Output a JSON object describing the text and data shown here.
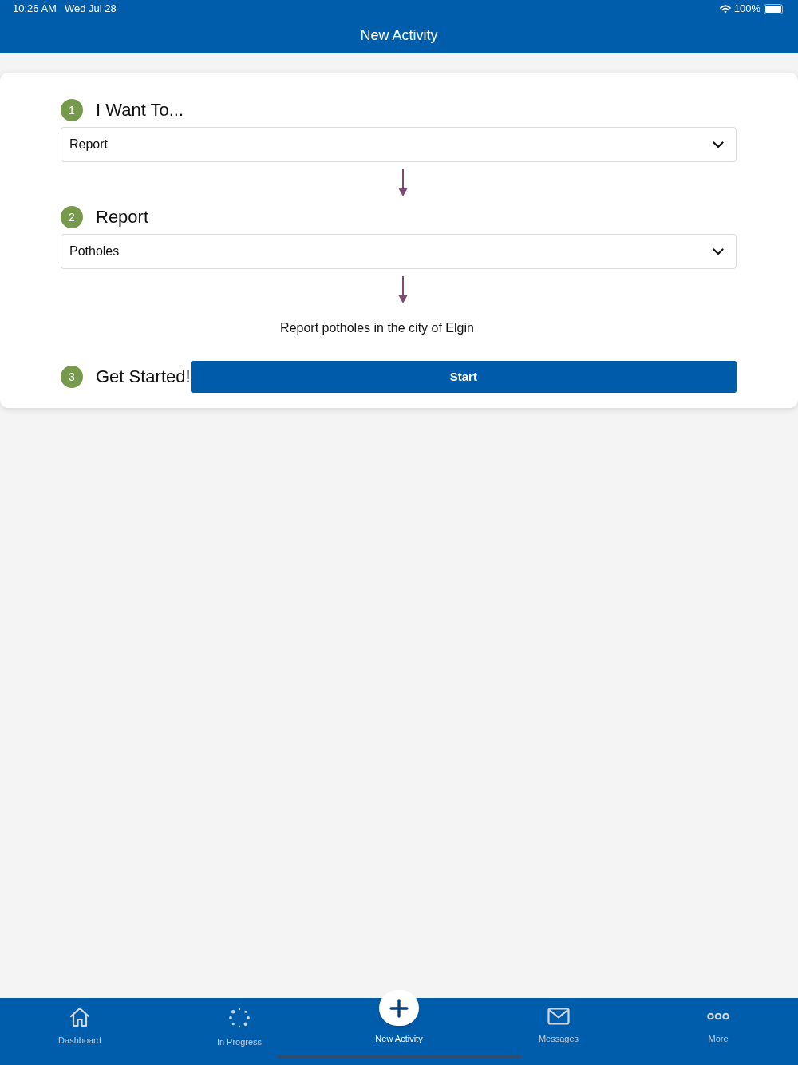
{
  "status_bar": {
    "time": "10:26 AM",
    "date": "Wed Jul 28",
    "battery": "100%"
  },
  "header": {
    "title": "New Activity"
  },
  "steps": [
    {
      "number": "1",
      "title": "I Want To...",
      "kind": "select",
      "value": "Report"
    },
    {
      "number": "2",
      "title": "Report",
      "kind": "select",
      "value": "Potholes",
      "description": "Report potholes in the city of Elgin"
    },
    {
      "number": "3",
      "title": "Get Started!",
      "kind": "button",
      "button": "Start"
    }
  ],
  "tab_bar": {
    "tabs": [
      {
        "label": "Dashboard",
        "kind": "icon",
        "selected": false
      },
      {
        "label": "In Progress",
        "kind": "icon",
        "selected": false
      },
      {
        "label": "New Activity",
        "kind": "fab",
        "selected": true
      },
      {
        "label": "Messages",
        "kind": "icon",
        "selected": false
      },
      {
        "label": "More",
        "kind": "icon",
        "selected": false
      }
    ]
  }
}
